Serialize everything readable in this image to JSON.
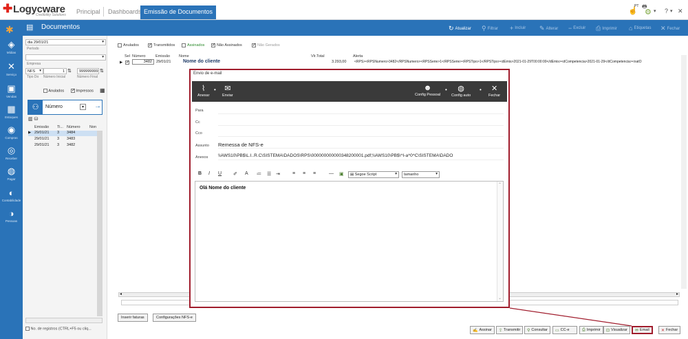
{
  "app": {
    "logo_text": "Logycware",
    "logo_sub": "Credibility Solutions",
    "tabs": [
      {
        "label": "Principal"
      },
      {
        "label": "Dashboards"
      },
      {
        "label": "Emissão de Documentos"
      }
    ],
    "lang": "PT",
    "help": "?"
  },
  "toolbar": {
    "title": "Documentos",
    "buttons": [
      {
        "label": "Atualizar",
        "icon": "refresh-icon"
      },
      {
        "label": "Filtrar",
        "icon": "filter-icon"
      },
      {
        "label": "Incluir",
        "icon": "plus-icon"
      },
      {
        "label": "Alterar",
        "icon": "edit-icon"
      },
      {
        "label": "Excluir",
        "icon": "minus-icon"
      },
      {
        "label": "Imprimir",
        "icon": "printer-icon"
      },
      {
        "label": "Etiquetas",
        "icon": "tag-icon"
      },
      {
        "label": "Fechar",
        "icon": "close-icon"
      }
    ]
  },
  "nav": [
    {
      "label": "Mídias",
      "icon": "media-icon"
    },
    {
      "label": "Serviço",
      "icon": "tools-icon"
    },
    {
      "label": "Vendas",
      "icon": "sales-icon"
    },
    {
      "label": "Estoques",
      "icon": "stock-icon"
    },
    {
      "label": "Compras",
      "icon": "cart-icon"
    },
    {
      "label": "Receber",
      "icon": "receive-icon"
    },
    {
      "label": "Pagar",
      "icon": "pay-icon"
    },
    {
      "label": "Contabilidade",
      "icon": "accounting-icon"
    },
    {
      "label": "Pessoas",
      "icon": "people-icon"
    }
  ],
  "filter": {
    "date_value": "dia 29/01/21",
    "periodo_label": "Período",
    "empresa_label": "Empresa",
    "tipo_value": "NFS",
    "tipo_label": "Tipo Do",
    "num_inicial_value": "1",
    "num_inicial_label": "Número Inicial",
    "num_final_value": "999999999",
    "num_final_label": "Número Final",
    "anulados_label": "Anulados",
    "impressos_label": "Impressos",
    "search_field": "Número",
    "grid_headers": [
      "Emissão",
      "Ti...",
      "Número",
      "Non"
    ],
    "grid_rows": [
      [
        "29/01/21",
        "3",
        "3484"
      ],
      [
        "29/01/21",
        "3",
        "3483"
      ],
      [
        "29/01/21",
        "3",
        "3482"
      ]
    ],
    "footer": "No. de registros (CTRL+F5 ou cliq..."
  },
  "status_flags": [
    {
      "label": "Anulados",
      "checked": false
    },
    {
      "label": "Transmitidos",
      "checked": true
    },
    {
      "label": "Assinados",
      "checked": false
    },
    {
      "label": "Não Assinados",
      "checked": true
    },
    {
      "label": "Não Gerados",
      "checked": true
    }
  ],
  "main_grid": {
    "headers": [
      "Sel",
      "Número",
      "Emissão",
      "Nome",
      "Vlr.Total",
      "Alerta"
    ],
    "row": {
      "numero": "3482",
      "emissao": "29/01/21",
      "nome": "Nome do cliente",
      "valor": "3.293,00",
      "alerta": "<RPS><RPSNumero>3482</RPSNumero><RPSSerie>1</RPSSerie><RPSTipo>1</RPSTipo><dEmis>2021-01-29T00:00:00</dEmis><dCompetencia>2021-01-29</dCompetencia><natO"
    }
  },
  "dialog": {
    "title": "Envio de e-mail",
    "buttons": [
      {
        "label": "Anexar",
        "icon": "paperclip-icon"
      },
      {
        "label": "Enviar",
        "icon": "send-mail-icon"
      },
      {
        "label": "Config Pessoal",
        "icon": "user-config-icon"
      },
      {
        "label": "Config auto",
        "icon": "globe-icon"
      },
      {
        "label": "Fechar",
        "icon": "close-icon"
      }
    ],
    "fields": {
      "para_label": "Para",
      "cc_label": "Cc",
      "cco_label": "Cco",
      "assunto_label": "Assunto",
      "assunto_value": "Remessa de NFS-e",
      "anexos_label": "Anexos",
      "anexos_value": "\\\\AWS10\\PB$\\L.I..R.C\\SISTEMA\\DADOS\\RPS\\000000000000348200001.pdf;\\\\AWS10\\PB$\\^I-a^0^C\\SISTEMA\\DADO"
    },
    "format": {
      "font": "Segoe Script",
      "size": "tamanho"
    },
    "body_text": "Olá Nome do cliente"
  },
  "bottom": {
    "inserir": "Inserir faturas",
    "config": "Configurações NFS-e",
    "buttons": [
      {
        "label": "Assinar"
      },
      {
        "label": "Transmitir"
      },
      {
        "label": "Consultar"
      },
      {
        "label": "CC-e"
      },
      {
        "label": "Imprimir"
      },
      {
        "label": "Visualizar"
      },
      {
        "label": "Email"
      },
      {
        "label": "Fechar"
      }
    ]
  },
  "colors": {
    "primary": "#2a73b8",
    "highlight": "#a01c2c",
    "dialog_bar": "#3a3a3a"
  }
}
